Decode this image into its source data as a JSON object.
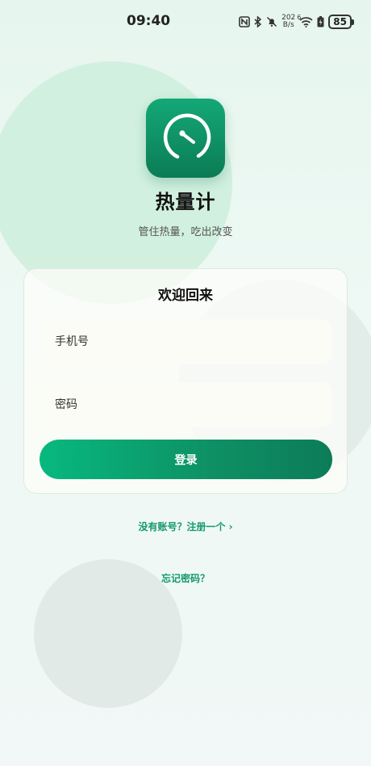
{
  "status_bar": {
    "time": "09:40",
    "net_speed_value": "202",
    "net_speed_unit": "B/s",
    "signal_label": "6",
    "battery": "85"
  },
  "app": {
    "name": "热量计",
    "slogan": "管住热量，吃出改变",
    "logo_icon": "gauge-icon",
    "accent_color": "#0e9a6a"
  },
  "login_card": {
    "title": "欢迎回来",
    "phone_placeholder": "手机号",
    "password_placeholder": "密码",
    "login_label": "登录"
  },
  "links": {
    "register": "没有账号？注册一个 ›",
    "forgot": "忘记密码？"
  }
}
